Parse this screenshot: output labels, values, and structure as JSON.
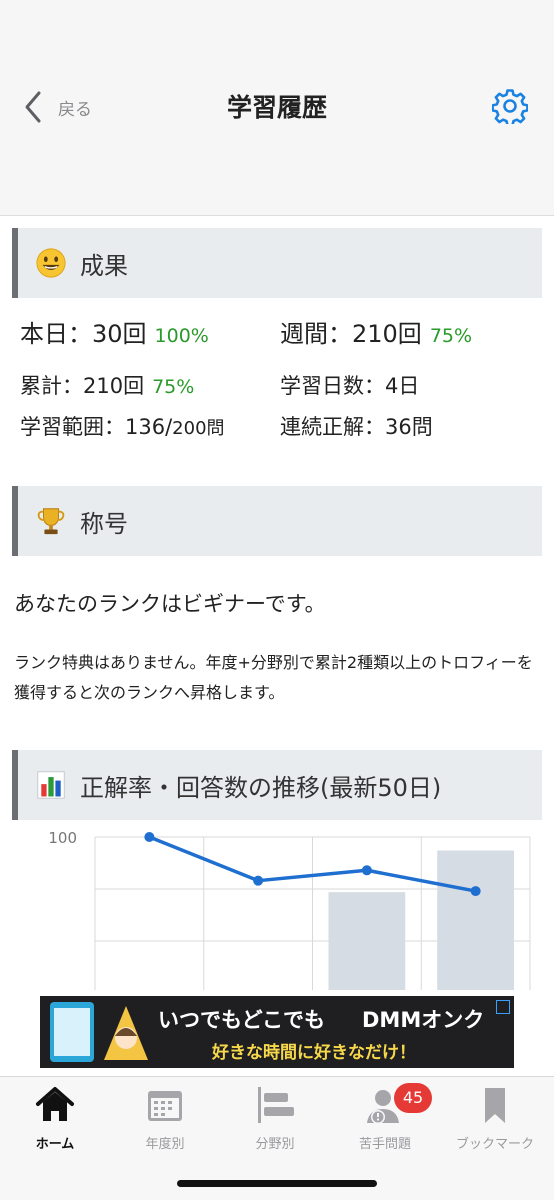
{
  "header": {
    "back_label": "戻る",
    "title": "学習履歴"
  },
  "results": {
    "heading": "成果",
    "today_label": "本日：30回",
    "today_pct": "100%",
    "week_label": "週間：210回",
    "week_pct": "75%",
    "total_label": "累計：210回",
    "total_pct": "75%",
    "days_label": "学習日数：4日",
    "range_label": "学習範囲：136/",
    "range_total": "200問",
    "streak_label": "連続正解：36問"
  },
  "title_section": {
    "heading": "称号",
    "rank_text": "あなたのランクはビギナーです。",
    "rank_note": "ランク特典はありません。年度+分野別で累計2種類以上のトロフィーを獲得すると次のランクへ昇格します。"
  },
  "chart_section": {
    "heading": "正解率・回答数の推移(最新50日)"
  },
  "chart_data": {
    "type": "line",
    "y_tick_labels": [
      "100"
    ],
    "ylim": [
      0,
      100
    ],
    "series": [
      {
        "type": "line",
        "values": [
          100,
          58,
          68,
          48
        ]
      },
      {
        "type": "bar",
        "values": [
          null,
          null,
          47,
          87
        ]
      }
    ],
    "grid": true
  },
  "ad": {
    "line1": "いつでもどこでも",
    "logo": "DMMオンク",
    "line2": "好きな時間に好きなだけ！"
  },
  "tabs": [
    {
      "label": "ホーム",
      "icon": "home-icon"
    },
    {
      "label": "年度別",
      "icon": "calendar-icon"
    },
    {
      "label": "分野別",
      "icon": "category-bars-icon"
    },
    {
      "label": "苦手問題",
      "icon": "weak-user-icon",
      "badge": "45"
    },
    {
      "label": "ブックマーク",
      "icon": "bookmark-icon"
    }
  ],
  "colors": {
    "accent": "#1a82e2",
    "green": "#2a9a2a",
    "line": "#1f6fd0",
    "bar": "#d5dce3",
    "badge": "#e53935"
  }
}
